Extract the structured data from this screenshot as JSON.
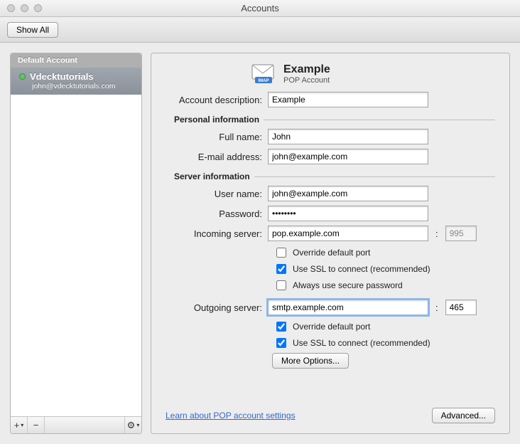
{
  "window": {
    "title": "Accounts"
  },
  "toolbar": {
    "show_all_label": "Show All"
  },
  "sidebar": {
    "group_title": "Default Account",
    "account": {
      "name": "Vdecktutorials",
      "email": "john@vdecktutorials.com"
    },
    "footer": {
      "add_label": "+",
      "remove_label": "−",
      "gear_label": "⚙"
    }
  },
  "header": {
    "title": "Example",
    "subtitle": "POP Account"
  },
  "labels": {
    "description": "Account description:",
    "personal_info": "Personal information",
    "full_name": "Full name:",
    "email": "E-mail address:",
    "server_info": "Server information",
    "user_name": "User name:",
    "password": "Password:",
    "incoming": "Incoming server:",
    "outgoing": "Outgoing server:",
    "override_port": "Override default port",
    "use_ssl": "Use SSL to connect (recommended)",
    "secure_pw": "Always use secure password",
    "more_options": "More Options...",
    "learn_link": "Learn about POP account settings",
    "advanced": "Advanced..."
  },
  "values": {
    "description": "Example",
    "full_name": "John",
    "email": "john@example.com",
    "user_name": "john@example.com",
    "password": "••••••••",
    "incoming_server": "pop.example.com",
    "incoming_port": "995",
    "incoming_override": false,
    "incoming_ssl": true,
    "incoming_secure_pw": false,
    "outgoing_server": "smtp.example.com",
    "outgoing_port": "465",
    "outgoing_override": true,
    "outgoing_ssl": true
  }
}
